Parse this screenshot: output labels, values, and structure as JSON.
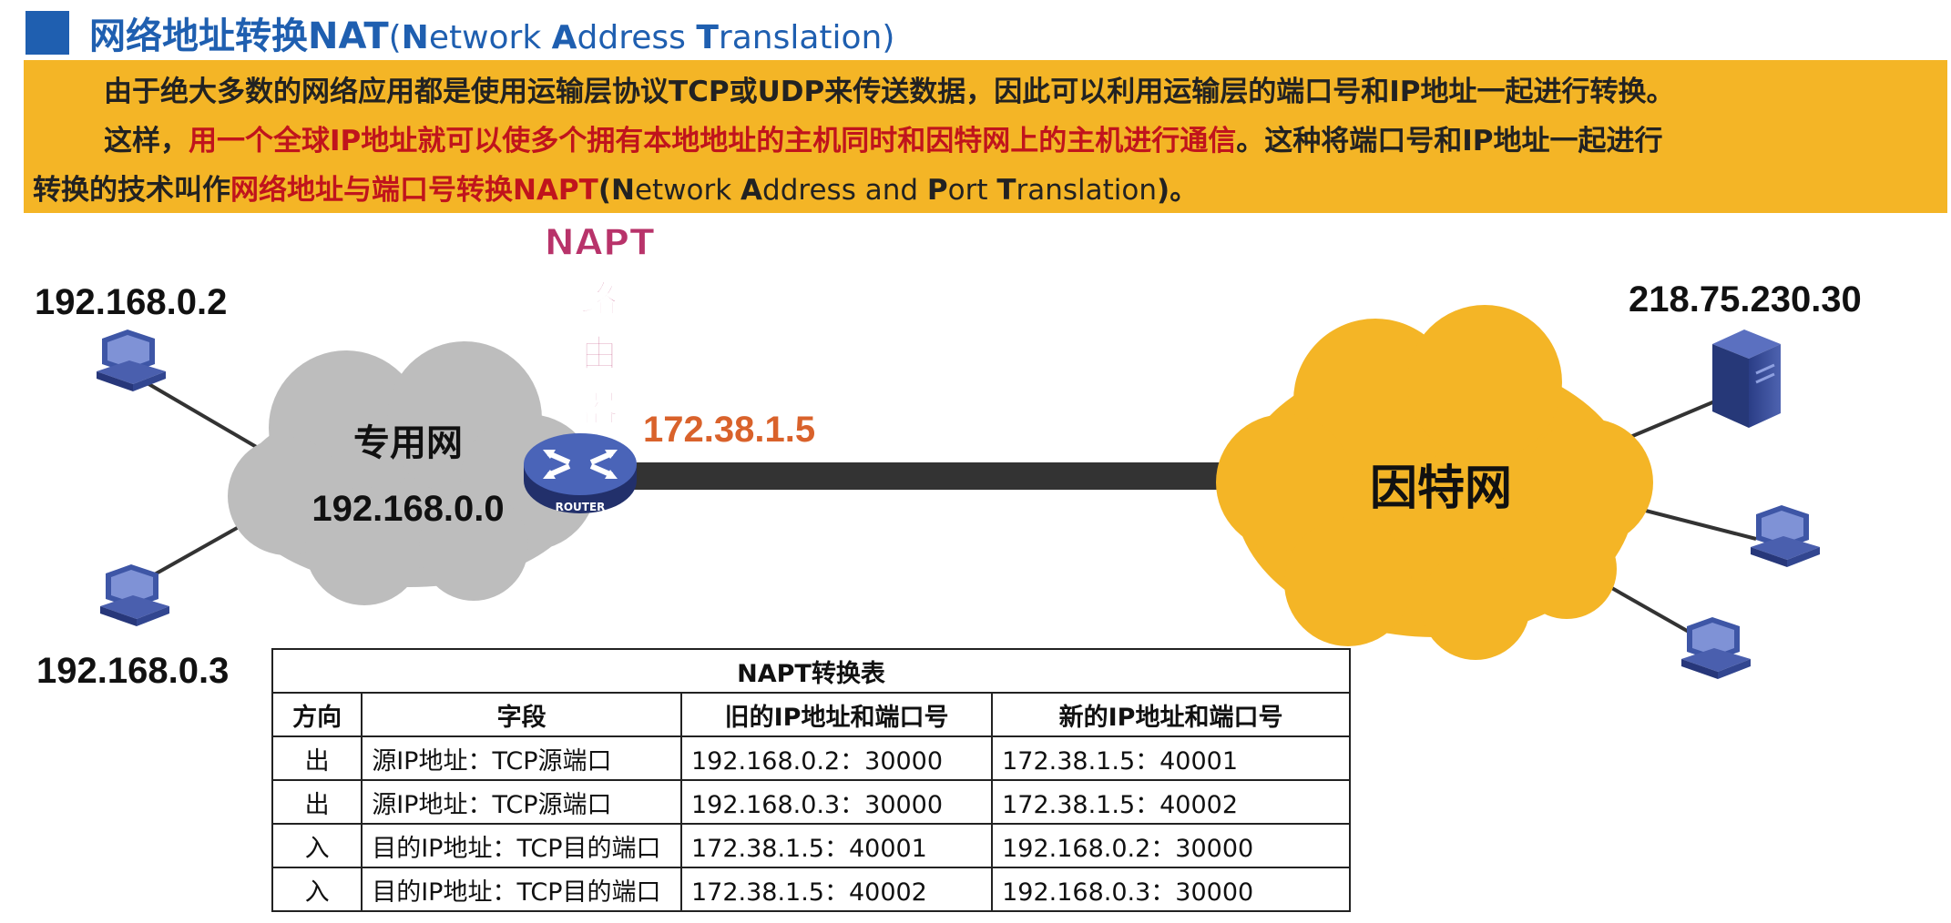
{
  "header": {
    "title_cn": "网络地址转换NAT",
    "title_en_open": "(",
    "title_en": [
      {
        "init": "N",
        "rest": "etwork "
      },
      {
        "init": "A",
        "rest": "ddress "
      },
      {
        "init": "T",
        "rest": "ranslation"
      }
    ],
    "title_en_close": ")"
  },
  "intro": {
    "line1": "由于绝大多数的网络应用都是使用运输层协议TCP或UDP来传送数据，因此可以利用运输层的端口号和IP地址一起进行转换。",
    "line2_a": "这样，",
    "line2_red": "用一个全球IP地址就可以使多个拥有本地地址的主机同时和因特网上的主机进行通信",
    "line2_b": "。这种将端口号和IP地址一起进行",
    "line3_a": "转换的技术叫作",
    "line3_red": "网络地址与端口号转换NAPT",
    "line3_en_open": "(",
    "line3_en": [
      {
        "init": "N",
        "rest": "etwork "
      },
      {
        "init": "A",
        "rest": "ddress and "
      },
      {
        "init": "P",
        "rest": "ort "
      },
      {
        "init": "T",
        "rest": "ranslation"
      }
    ],
    "line3_end": ")。"
  },
  "diagram": {
    "host1_ip": "192.168.0.2",
    "host2_ip": "192.168.0.3",
    "private_net_label": "专用网",
    "private_net_addr": "192.168.0.0",
    "router_label": "NAPT",
    "router_label_chars": [
      "路",
      "由",
      "器"
    ],
    "router_ip": "172.38.1.5",
    "router_icon_text": "ROUTER",
    "internet_label": "因特网",
    "server_ip": "218.75.230.30",
    "colors": {
      "private_cloud": "#bdbdbd",
      "internet_cloud": "#f4b526",
      "router": "#3b4f9c",
      "router_ip": "#d9622b",
      "router_label": "#b8336a"
    }
  },
  "table": {
    "title": "NAPT转换表",
    "headers": [
      "方向",
      "字段",
      "旧的IP地址和端口号",
      "新的IP地址和端口号"
    ],
    "rows": [
      [
        "出",
        "源IP地址：TCP源端口",
        "192.168.0.2：30000",
        "172.38.1.5：40001"
      ],
      [
        "出",
        "源IP地址：TCP源端口",
        "192.168.0.3：30000",
        "172.38.1.5：40002"
      ],
      [
        "入",
        "目的IP地址：TCP目的端口",
        "172.38.1.5：40001",
        "192.168.0.2：30000"
      ],
      [
        "入",
        "目的IP地址：TCP目的端口",
        "172.38.1.5：40002",
        "192.168.0.3：30000"
      ]
    ]
  }
}
